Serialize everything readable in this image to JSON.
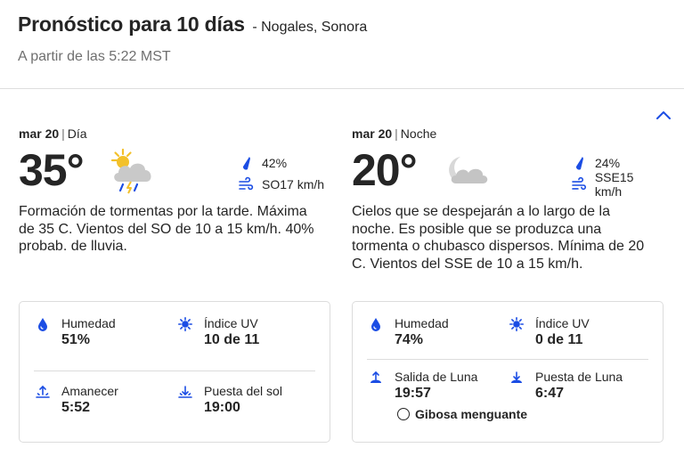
{
  "header": {
    "title": "Pronóstico para 10 días",
    "location": "- Nogales, Sonora",
    "updated": "A partir de las 5:22 MST"
  },
  "day": {
    "date": "mar 20",
    "period": "Día",
    "temp": "35°",
    "icon": "thunderstorm-icon",
    "precip": "42%",
    "wind": "SO17 km/h",
    "description": "Formación de tormentas por la tarde. Máxima de 35 C. Vientos del SO de 10 a 15 km/h. 40% probab. de lluvia.",
    "details": {
      "humidity_label": "Humedad",
      "humidity": "51%",
      "uv_label": "Índice UV",
      "uv": "10 de 11",
      "sunrise_label": "Amanecer",
      "sunrise": "5:52",
      "sunset_label": "Puesta del sol",
      "sunset": "19:00"
    }
  },
  "night": {
    "date": "mar 20",
    "period": "Noche",
    "temp": "20°",
    "icon": "partly-cloudy-night-icon",
    "precip": "24%",
    "wind": "SSE15 km/h",
    "description": "Cielos que se despejarán a lo largo de la noche. Es posible que se produzca una tormenta o chubasco dispersos. Mínima de 20 C. Vientos del SSE de 10 a 15 km/h.",
    "details": {
      "humidity_label": "Humedad",
      "humidity": "74%",
      "uv_label": "Índice UV",
      "uv": "0 de 11",
      "moonrise_label": "Salida de Luna",
      "moonrise": "19:57",
      "moonset_label": "Puesta de Luna",
      "moonset": "6:47",
      "moon_phase": "Gibosa menguante"
    }
  },
  "colors": {
    "icon_blue": "#1b4de4",
    "text": "#252525",
    "muted": "#6f6f6f",
    "border": "#dcdcdc"
  }
}
